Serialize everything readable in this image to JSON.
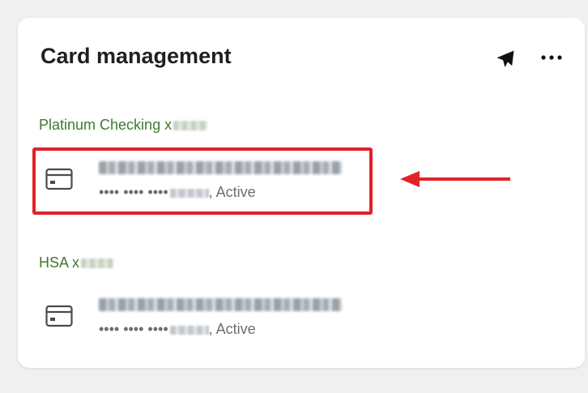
{
  "panel": {
    "title": "Card management",
    "header_icons": [
      "plane-icon",
      "more-horizontal-icon"
    ]
  },
  "accounts": [
    {
      "label": "Platinum Checking x",
      "card": {
        "icon": "credit-card-icon",
        "masked_number": "•••• •••• ••••",
        "status": ", Active"
      }
    },
    {
      "label": "HSA x",
      "card": {
        "icon": "credit-card-icon",
        "masked_number": "•••• •••• ••••",
        "status": ", Active"
      }
    }
  ],
  "annotation": {
    "highlight_color": "#e3222b",
    "arrow_color": "#e3222b"
  },
  "colors": {
    "account_label": "#3f7a2f",
    "title": "#1f1f1f",
    "status_text": "#6e6e6e"
  }
}
